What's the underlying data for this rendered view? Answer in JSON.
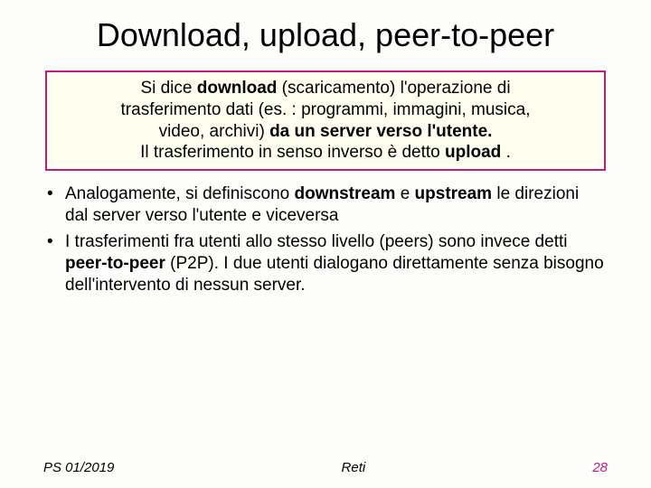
{
  "title": "Download, upload, peer-to-peer",
  "definition": {
    "l1a": "Si dice ",
    "l1b": "download",
    "l1c": " (scaricamento) l'operazione di",
    "l2": "trasferimento dati (es. : programmi, immagini, musica,",
    "l3a": "video, archivi) ",
    "l3b": "da un server verso l'utente.",
    "l4a": "Il trasferimento in senso inverso è detto ",
    "l4b": "upload",
    "l4c": " ."
  },
  "bullets": [
    {
      "p1": "Analogamente, si definiscono ",
      "b1": "downstream",
      "p2": " e ",
      "b2": "upstream",
      "p3": " le direzioni dal server verso l'utente e viceversa"
    },
    {
      "p1": "I trasferimenti fra utenti allo stesso livello (peers) sono invece detti ",
      "b1": "peer-to-peer",
      "p2": " (P2P). I due utenti dialogano direttamente senza bisogno dell'intervento di nessun server."
    }
  ],
  "footer": {
    "left": "PS 01/2019",
    "center": "Reti",
    "page": "28"
  }
}
